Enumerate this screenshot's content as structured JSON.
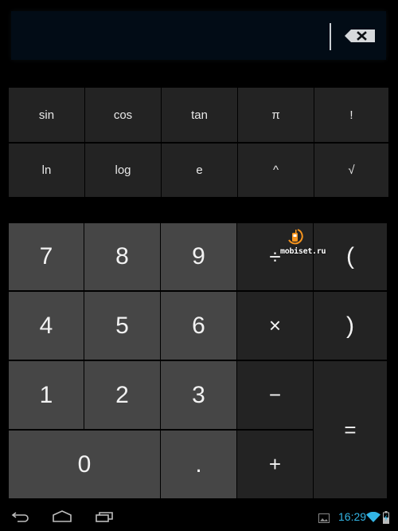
{
  "display": {
    "expression": "",
    "backspace_icon": "backspace-icon"
  },
  "function_keys": [
    {
      "label": "sin",
      "name": "sin-button"
    },
    {
      "label": "cos",
      "name": "cos-button"
    },
    {
      "label": "tan",
      "name": "tan-button"
    },
    {
      "label": "π",
      "name": "pi-button"
    },
    {
      "label": "!",
      "name": "factorial-button"
    },
    {
      "label": "ln",
      "name": "ln-button"
    },
    {
      "label": "log",
      "name": "log-button"
    },
    {
      "label": "e",
      "name": "e-button"
    },
    {
      "label": "^",
      "name": "power-button"
    },
    {
      "label": "√",
      "name": "sqrt-button"
    }
  ],
  "keypad": {
    "seven": "7",
    "eight": "8",
    "nine": "9",
    "divide": "÷",
    "open_paren": "(",
    "four": "4",
    "five": "5",
    "six": "6",
    "multiply": "×",
    "close_paren": ")",
    "one": "1",
    "two": "2",
    "three": "3",
    "minus": "−",
    "equals": "=",
    "zero": "0",
    "dot": ".",
    "plus": "+"
  },
  "watermark": {
    "text": "mobiset.ru",
    "color": "#f7941d"
  },
  "navbar": {
    "back_icon": "back-icon",
    "home_icon": "home-icon",
    "recents_icon": "recent-apps-icon"
  },
  "status_bar": {
    "time": "16:29",
    "accent_color": "#33b5e5"
  }
}
